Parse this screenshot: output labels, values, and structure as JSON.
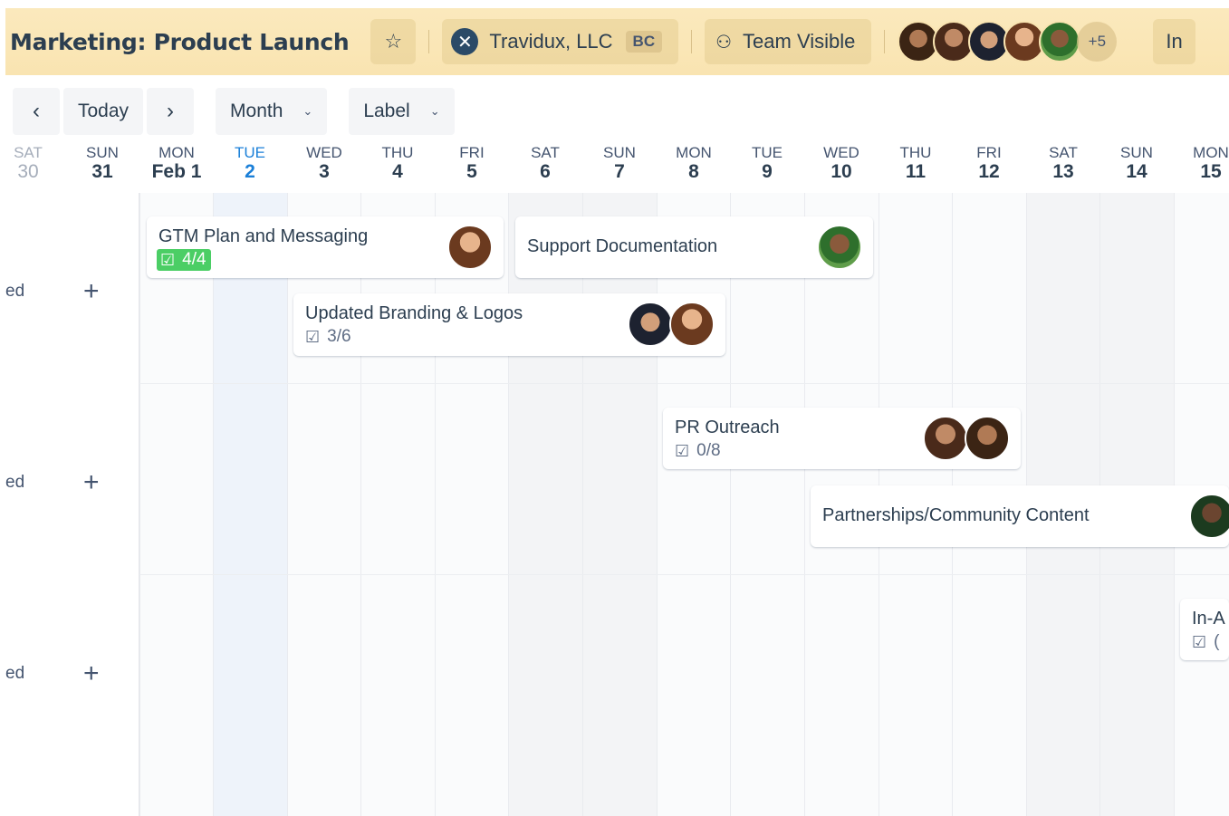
{
  "header": {
    "board_title": "Marketing: Product Launch",
    "star_icon": "star-icon",
    "workspace_name": "Travidux, LLC",
    "workspace_badge": "BC",
    "workspace_logo_icon": "workspace-logo-icon",
    "visibility_label": "Team Visible",
    "visibility_icon": "team-icon",
    "more_members_label": "+5",
    "invite_label": "In"
  },
  "toolbar": {
    "prev_icon": "chevron-left-icon",
    "today_label": "Today",
    "next_icon": "chevron-right-icon",
    "view_label": "Month",
    "label_filter": "Label"
  },
  "days": [
    {
      "dname": "SAT",
      "dnum": "30",
      "state": "faded"
    },
    {
      "dname": "SUN",
      "dnum": "31",
      "state": "normal"
    },
    {
      "dname": "MON",
      "dnum": "Feb 1",
      "state": "normal"
    },
    {
      "dname": "TUE",
      "dnum": "2",
      "state": "today"
    },
    {
      "dname": "WED",
      "dnum": "3",
      "state": "normal"
    },
    {
      "dname": "THU",
      "dnum": "4",
      "state": "normal"
    },
    {
      "dname": "FRI",
      "dnum": "5",
      "state": "normal"
    },
    {
      "dname": "SAT",
      "dnum": "6",
      "state": "normal"
    },
    {
      "dname": "SUN",
      "dnum": "7",
      "state": "normal"
    },
    {
      "dname": "MON",
      "dnum": "8",
      "state": "normal"
    },
    {
      "dname": "TUE",
      "dnum": "9",
      "state": "normal"
    },
    {
      "dname": "WED",
      "dnum": "10",
      "state": "normal"
    },
    {
      "dname": "THU",
      "dnum": "11",
      "state": "normal"
    },
    {
      "dname": "FRI",
      "dnum": "12",
      "state": "normal"
    },
    {
      "dname": "SAT",
      "dnum": "13",
      "state": "normal"
    },
    {
      "dname": "SUN",
      "dnum": "14",
      "state": "normal"
    },
    {
      "dname": "MON",
      "dnum": "15",
      "state": "normal"
    }
  ],
  "rows": [
    {
      "label": "ed",
      "add": "+"
    },
    {
      "label": "ed",
      "add": "+"
    },
    {
      "label": "ed",
      "add": "+"
    }
  ],
  "cards": [
    {
      "title": "GTM Plan and Messaging",
      "checklist": "4/4",
      "checklist_complete": true,
      "members": 1
    },
    {
      "title": "Support Documentation",
      "members": 1
    },
    {
      "title": "Updated Branding & Logos",
      "checklist": "3/6",
      "checklist_complete": false,
      "members": 2
    },
    {
      "title": "PR Outreach",
      "checklist": "0/8",
      "checklist_complete": false,
      "members": 2
    },
    {
      "title": "Partnerships/Community Content",
      "members": 1
    },
    {
      "title": "In-A",
      "checklist": "(",
      "checklist_complete": false,
      "members": 0
    }
  ],
  "colors": {
    "header_bg": "#f9e4b1",
    "today_accent": "#1a7fd8",
    "checklist_complete": "#4bce65"
  }
}
